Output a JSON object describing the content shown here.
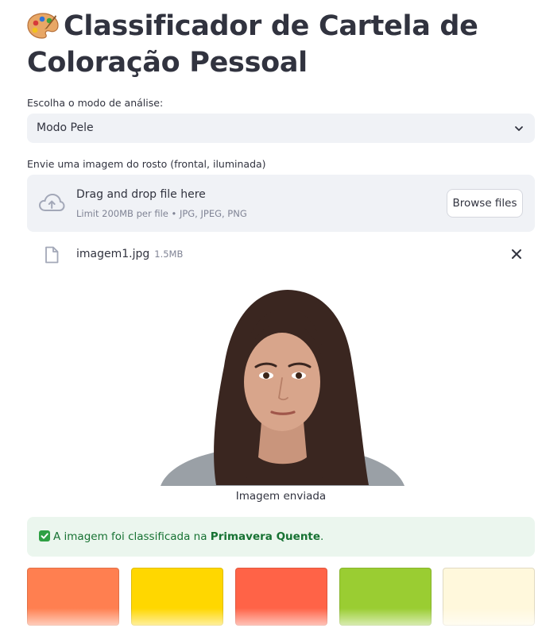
{
  "header": {
    "title": "Classificador de Cartela de Coloração Pessoal",
    "emoji_icon": "palette-icon"
  },
  "mode_select": {
    "label": "Escolha o modo de análise:",
    "selected": "Modo Pele"
  },
  "uploader": {
    "label": "Envie uma imagem do rosto (frontal, iluminada)",
    "drop_text": "Drag and drop file here",
    "limit_text": "Limit 200MB per file • JPG, JPEG, PNG",
    "browse_label": "Browse files"
  },
  "uploaded_file": {
    "name": "imagem1.jpg",
    "size": "1.5MB"
  },
  "image": {
    "caption": "Imagem enviada"
  },
  "result": {
    "prefix": "A imagem foi classificada na ",
    "class_name": "Primavera Quente",
    "suffix": "."
  },
  "palette": {
    "colors": [
      "#ff7f50",
      "#ffd700",
      "#ff6347",
      "#9acd32",
      "#fff8dc"
    ]
  }
}
